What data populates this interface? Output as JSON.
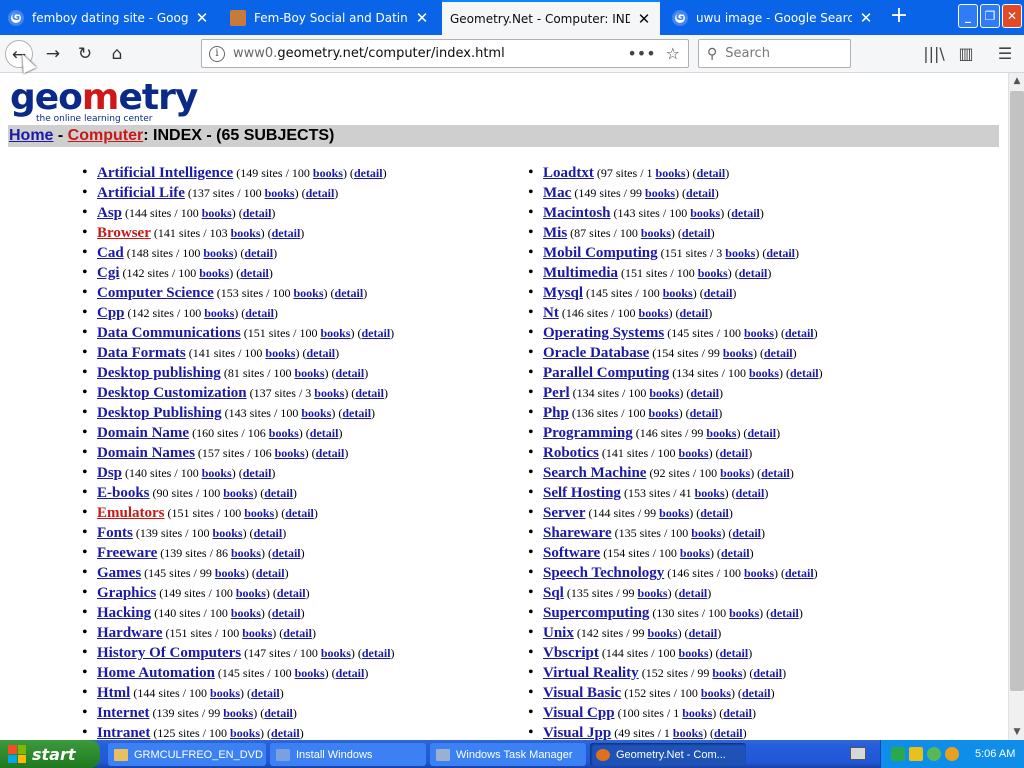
{
  "browser": {
    "tabs": [
      {
        "label": "femboy dating site - Google Search",
        "icon": "google-icon",
        "active": false
      },
      {
        "label": "Fem-Boy Social and Dating.Street",
        "icon": "site-icon",
        "active": false
      },
      {
        "label": "Geometry.Net - Computer: INDEX",
        "icon": "",
        "active": true
      },
      {
        "label": "uwu image - Google Search",
        "icon": "google-icon",
        "active": false
      }
    ],
    "close_glyph": "✕",
    "new_tab_glyph": "+",
    "window_buttons": [
      "_",
      "❐",
      "✕"
    ],
    "nav": {
      "back": "←",
      "forward": "→",
      "reload": "↻",
      "home": "⌂"
    },
    "url": {
      "prefix": "www0.",
      "host": "geometry.net/computer/index.html"
    },
    "url_icons": {
      "info": "i",
      "more": "•••",
      "bookmark": "☆"
    },
    "search_placeholder": "Search",
    "search_icon": "⚲",
    "toolbar_icons": {
      "library": "|||\\",
      "sidebar": "▥",
      "menu": "☰"
    }
  },
  "page": {
    "logo": {
      "part1": "geo",
      "part2": "m",
      "part3": "etry",
      "tagline": "the online learning center"
    },
    "breadcrumb": {
      "home": "Home",
      "sep": " - ",
      "section": "Computer",
      "rest": ": INDEX - (65 SUBJECTS)"
    },
    "left_column": [
      {
        "name": "Artificial Intelligence",
        "sites": "149 sites",
        "books": "100",
        "hot": false
      },
      {
        "name": "Artificial Life",
        "sites": "137 sites",
        "books": "100",
        "hot": false
      },
      {
        "name": "Asp",
        "sites": "144 sites",
        "books": "100",
        "hot": false
      },
      {
        "name": "Browser",
        "sites": "141 sites",
        "books": "103",
        "hot": true
      },
      {
        "name": "Cad",
        "sites": "148 sites",
        "books": "100",
        "hot": false
      },
      {
        "name": "Cgi",
        "sites": "142 sites",
        "books": "100",
        "hot": false
      },
      {
        "name": "Computer Science",
        "sites": "153 sites",
        "books": "100",
        "hot": false
      },
      {
        "name": "Cpp",
        "sites": "142 sites",
        "books": "100",
        "hot": false
      },
      {
        "name": "Data Communications",
        "sites": "151 sites",
        "books": "100",
        "hot": false
      },
      {
        "name": "Data Formats",
        "sites": "141 sites",
        "books": "100",
        "hot": false
      },
      {
        "name": "Desktop publishing",
        "sites": "81 sites",
        "books": "100",
        "hot": false
      },
      {
        "name": "Desktop Customization",
        "sites": "137 sites",
        "books": "3",
        "hot": false
      },
      {
        "name": "Desktop Publishing",
        "sites": "143 sites",
        "books": "100",
        "hot": false
      },
      {
        "name": "Domain Name",
        "sites": "160 sites",
        "books": "106",
        "hot": false
      },
      {
        "name": "Domain Names",
        "sites": "157 sites",
        "books": "106",
        "hot": false
      },
      {
        "name": "Dsp",
        "sites": "140 sites",
        "books": "100",
        "hot": false
      },
      {
        "name": "E-books",
        "sites": "90 sites",
        "books": "100",
        "hot": false
      },
      {
        "name": "Emulators",
        "sites": "151 sites",
        "books": "100",
        "hot": true
      },
      {
        "name": "Fonts",
        "sites": "139 sites",
        "books": "100",
        "hot": false
      },
      {
        "name": "Freeware",
        "sites": "139 sites",
        "books": "86",
        "hot": false
      },
      {
        "name": "Games",
        "sites": "145 sites",
        "books": "99",
        "hot": false
      },
      {
        "name": "Graphics",
        "sites": "149 sites",
        "books": "100",
        "hot": false
      },
      {
        "name": "Hacking",
        "sites": "140 sites",
        "books": "100",
        "hot": false
      },
      {
        "name": "Hardware",
        "sites": "151 sites",
        "books": "100",
        "hot": false
      },
      {
        "name": "History Of Computers",
        "sites": "147 sites",
        "books": "100",
        "hot": false
      },
      {
        "name": "Home Automation",
        "sites": "145 sites",
        "books": "100",
        "hot": false
      },
      {
        "name": "Html",
        "sites": "144 sites",
        "books": "100",
        "hot": false
      },
      {
        "name": "Internet",
        "sites": "139 sites",
        "books": "99",
        "hot": false
      },
      {
        "name": "Intranet",
        "sites": "125 sites",
        "books": "100",
        "hot": false
      }
    ],
    "right_column": [
      {
        "name": "Loadtxt",
        "sites": "97 sites",
        "books": "1",
        "hot": false
      },
      {
        "name": "Mac",
        "sites": "149 sites",
        "books": "99",
        "hot": false
      },
      {
        "name": "Macintosh",
        "sites": "143 sites",
        "books": "100",
        "hot": false
      },
      {
        "name": "Mis",
        "sites": "87 sites",
        "books": "100",
        "hot": false
      },
      {
        "name": "Mobil Computing",
        "sites": "151 sites",
        "books": "3",
        "hot": false
      },
      {
        "name": "Multimedia",
        "sites": "151 sites",
        "books": "100",
        "hot": false
      },
      {
        "name": "Mysql",
        "sites": "145 sites",
        "books": "100",
        "hot": false
      },
      {
        "name": "Nt",
        "sites": "146 sites",
        "books": "100",
        "hot": false
      },
      {
        "name": "Operating Systems",
        "sites": "145 sites",
        "books": "100",
        "hot": false
      },
      {
        "name": "Oracle Database",
        "sites": "154 sites",
        "books": "99",
        "hot": false
      },
      {
        "name": "Parallel Computing",
        "sites": "134 sites",
        "books": "100",
        "hot": false
      },
      {
        "name": "Perl",
        "sites": "134 sites",
        "books": "100",
        "hot": false
      },
      {
        "name": "Php",
        "sites": "136 sites",
        "books": "100",
        "hot": false
      },
      {
        "name": "Programming",
        "sites": "146 sites",
        "books": "99",
        "hot": false
      },
      {
        "name": "Robotics",
        "sites": "141 sites",
        "books": "100",
        "hot": false
      },
      {
        "name": "Search Machine",
        "sites": "92 sites",
        "books": "100",
        "hot": false
      },
      {
        "name": "Self Hosting",
        "sites": "153 sites",
        "books": "41",
        "hot": false
      },
      {
        "name": "Server",
        "sites": "144 sites",
        "books": "99",
        "hot": false
      },
      {
        "name": "Shareware",
        "sites": "135 sites",
        "books": "100",
        "hot": false
      },
      {
        "name": "Software",
        "sites": "154 sites",
        "books": "100",
        "hot": false
      },
      {
        "name": "Speech Technology",
        "sites": "146 sites",
        "books": "100",
        "hot": false
      },
      {
        "name": "Sql",
        "sites": "135 sites",
        "books": "99",
        "hot": false
      },
      {
        "name": "Supercomputing",
        "sites": "130 sites",
        "books": "100",
        "hot": false
      },
      {
        "name": "Unix",
        "sites": "142 sites",
        "books": "99",
        "hot": false
      },
      {
        "name": "Vbscript",
        "sites": "144 sites",
        "books": "100",
        "hot": false
      },
      {
        "name": "Virtual Reality",
        "sites": "152 sites",
        "books": "99",
        "hot": false
      },
      {
        "name": "Visual Basic",
        "sites": "152 sites",
        "books": "100",
        "hot": false
      },
      {
        "name": "Visual Cpp",
        "sites": "100 sites",
        "books": "1",
        "hot": false
      },
      {
        "name": "Visual Jpp",
        "sites": "49 sites",
        "books": "1",
        "hot": false
      }
    ],
    "books_label": "books",
    "detail_label": "detail"
  },
  "taskbar": {
    "start": "start",
    "tasks": [
      {
        "label": "GRMCULFREO_EN_DVD",
        "color": "#e8c060",
        "active": false
      },
      {
        "label": "Install Windows",
        "color": "#7aa0e0",
        "active": false
      },
      {
        "label": "Windows Task Manager",
        "color": "#9ab0d0",
        "active": false
      },
      {
        "label": "Geometry.Net - Com...",
        "color": "#e07020",
        "active": true
      }
    ],
    "clock": "5:06 AM"
  },
  "colors": {
    "link": "#1a1aa6",
    "hot_link": "#c81818",
    "xp_blue": "#245edb",
    "firefox_blue": "#0a64e8"
  }
}
